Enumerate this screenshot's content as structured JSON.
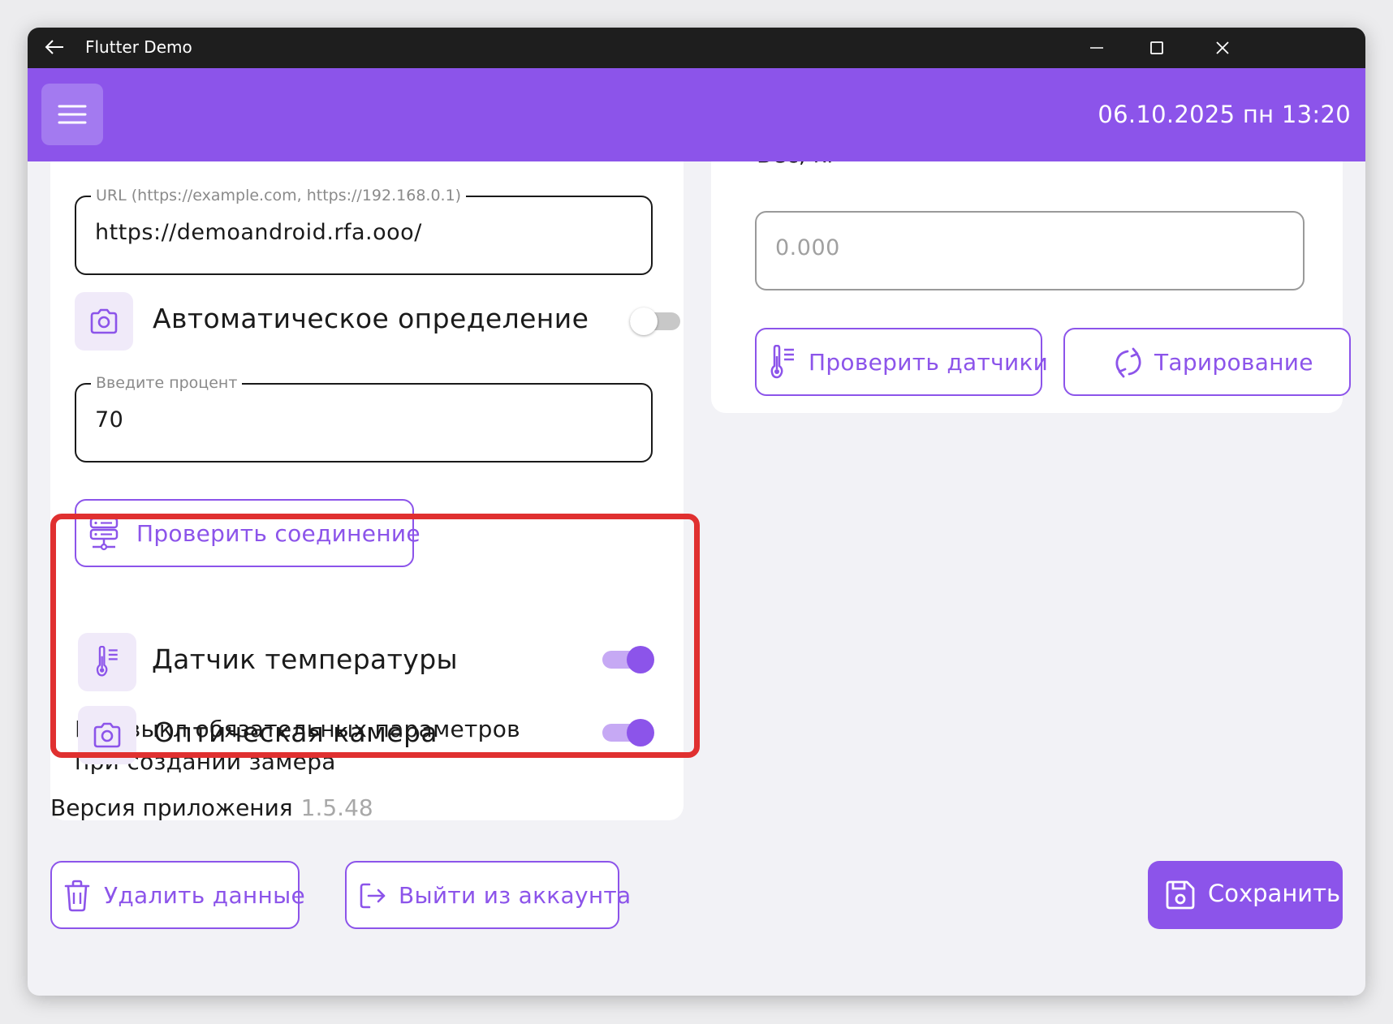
{
  "window": {
    "title": "Flutter Demo",
    "controls": [
      "minimize-icon",
      "maximize-icon",
      "close-icon"
    ]
  },
  "appbar": {
    "datetime": "06.10.2025 пн 13:20",
    "menu_icon": "menu-icon"
  },
  "left_card": {
    "url_field": {
      "label": "URL (https://example.com, https://192.168.0.1)",
      "value": "https://demoandroid.rfa.ooo/"
    },
    "auto_detect": {
      "label": "Автоматическое определение",
      "icon": "camera-icon",
      "enabled": false
    },
    "percent_field": {
      "label": "Введите процент",
      "value": "70"
    },
    "check_connection_button": {
      "label": "Проверить соединение",
      "icon": "server-icon"
    }
  },
  "required_params": {
    "title": "Вкл/выкл обязательных параметров при создании замера",
    "items": [
      {
        "label": "Датчик температуры",
        "icon": "thermometer-icon",
        "enabled": true
      },
      {
        "label": "Оптическая камера",
        "icon": "camera-icon",
        "enabled": true
      }
    ]
  },
  "right_card": {
    "weight_label": "Вес, кг",
    "weight_field": {
      "placeholder": "0.000"
    },
    "check_sensors_button": {
      "label": "Проверить датчики",
      "icon": "thermometer-icon"
    },
    "tare_button": {
      "label": "Тарирование",
      "icon": "refresh-icon"
    }
  },
  "version": {
    "label": "Версия приложения",
    "value": "1.5.48"
  },
  "footer": {
    "delete_button": {
      "label": "Удалить данные",
      "icon": "trash-icon"
    },
    "logout_button": {
      "label": "Выйти из аккаунта",
      "icon": "logout-icon"
    },
    "save_button": {
      "label": "Сохранить",
      "icon": "save-icon"
    }
  },
  "colors": {
    "accent": "#8c54ea",
    "highlight": "#e03030",
    "titlebar": "#1e1e1e"
  }
}
